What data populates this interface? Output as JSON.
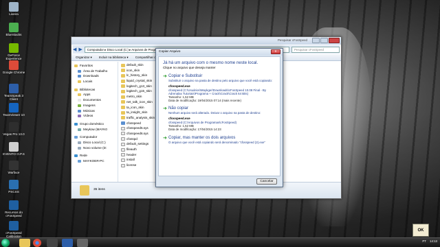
{
  "desktop": {
    "icons": [
      {
        "label": "Lixeira",
        "color": "#9fb4c8"
      },
      {
        "label": "BlueStacks",
        "color": "#4caf50"
      },
      {
        "label": "GeForce Experience",
        "color": "#76b900"
      },
      {
        "label": "Google Chrome",
        "color": "#dd4b39"
      },
      {
        "label": "TeamSpeak 3 Client",
        "color": "#2d5ea8"
      },
      {
        "label": "TeamViewer 10",
        "color": "#1565c0"
      },
      {
        "label": "Vegas Pro 13.0",
        "color": "#2e2e2e"
      },
      {
        "label": "EVENTO O.P.S",
        "color": "#cfcfcf"
      },
      {
        "label": "Warface",
        "color": "#333333"
      },
      {
        "label": "PSCSS",
        "color": "#2a6fb0"
      },
      {
        "label": "Recursos do cFosSpeed",
        "color": "#1f5fa0"
      },
      {
        "label": "cFosSpeed Calibration",
        "color": "#1f5fa0"
      }
    ]
  },
  "explorer": {
    "address_text": "Computador ▸ Disco Local (C:) ▸ Arquivos de Programas ▸ cFosSpeed ▸",
    "search_placeholder": "Pesquisar cFosSpeed",
    "title_right": "Pesquisar cFosSpeed",
    "toolbar": {
      "organize": "Organizar ▾",
      "include_library": "Incluir na biblioteca ▾",
      "share": "Compartilhar com ▾"
    },
    "nav": [
      {
        "label": "Favoritos",
        "head": true,
        "color": "#e8c65a"
      },
      {
        "label": "Área de Trabalho",
        "head": false,
        "color": "#5a8fd0"
      },
      {
        "label": "Downloads",
        "head": false,
        "color": "#5a8fd0"
      },
      {
        "label": "Locais",
        "head": false,
        "color": "#e8c65a"
      },
      {
        "label": "",
        "gap": true
      },
      {
        "label": "Bibliotecas",
        "head": true,
        "color": "#e8c65a"
      },
      {
        "label": "Apps",
        "head": false,
        "color": "#e8c65a"
      },
      {
        "label": "Documentos",
        "head": false,
        "color": "#e8e8e8"
      },
      {
        "label": "Imagens",
        "head": false,
        "color": "#7cb342"
      },
      {
        "label": "Músicas",
        "head": false,
        "color": "#5a8fd0"
      },
      {
        "label": "Vídeos",
        "head": false,
        "color": "#8e6fb8"
      },
      {
        "label": "",
        "gap": true
      },
      {
        "label": "Grupo doméstico",
        "head": true,
        "color": "#3a8fd0"
      },
      {
        "label": "Meykow (MAYK0",
        "head": false,
        "color": "#7aa"
      },
      {
        "label": "",
        "gap": true
      },
      {
        "label": "Computador",
        "head": true,
        "color": "#6aa0d8"
      },
      {
        "label": "Disco Local (C:)",
        "head": false,
        "color": "#9ab"
      },
      {
        "label": "Novo volume (D:",
        "head": false,
        "color": "#9ab"
      },
      {
        "label": "",
        "gap": true
      },
      {
        "label": "Rede",
        "head": true,
        "color": "#3a8fd0"
      },
      {
        "label": "MAYKOER-PC",
        "head": false,
        "color": "#6aa0d8"
      }
    ],
    "files": [
      {
        "label": "default_skin",
        "type": "folder"
      },
      {
        "label": "icon_skin",
        "type": "folder"
      },
      {
        "label": "lc_history_skin",
        "type": "folder"
      },
      {
        "label": "liquid_crystal_skin",
        "type": "folder"
      },
      {
        "label": "logitech_g13_skin",
        "type": "folder"
      },
      {
        "label": "logitech_g15_skin",
        "type": "folder"
      },
      {
        "label": "metro_skin",
        "type": "folder"
      },
      {
        "label": "net_talk_icon_skin",
        "type": "folder"
      },
      {
        "label": "ta_icon_skin",
        "type": "folder"
      },
      {
        "label": "ta_insight_skin",
        "type": "folder"
      },
      {
        "label": "traffic_analysis_skin",
        "type": "folder"
      },
      {
        "label": "cfosspeed",
        "type": "exe"
      },
      {
        "label": "cfosspeed5.sys",
        "type": "doc"
      },
      {
        "label": "cfosspeed6.sys",
        "type": "doc"
      },
      {
        "label": "cfosspd",
        "type": "doc"
      },
      {
        "label": "default_settings",
        "type": "doc"
      },
      {
        "label": "fileauth",
        "type": "doc"
      },
      {
        "label": "header",
        "type": "doc"
      },
      {
        "label": "install",
        "type": "doc"
      },
      {
        "label": "license",
        "type": "doc"
      }
    ],
    "status": "35 itens"
  },
  "dialog": {
    "title": "Copiar Arquivo",
    "close": "x",
    "heading": "Já há um arquivo com o mesmo nome neste local.",
    "subheading": "Clique no arquivo que deseja manter",
    "option_replace": {
      "title": "Copiar e Substituir",
      "desc": "Substituir o arquivo na pasta de destino pelo arquivo que você está copiando:",
      "file_name": "cfosspeed.exe",
      "path": "cfosspeed (C:\\Usuários\\Maykger\\Downloads\\cFosSpeed 10.08 Final - By Adrenalax Tutoriais\\Programa + Crack\\Crack\\Crack 64 Bits)",
      "size": "Tamanho: 1,52 MB",
      "date": "Data de modificação: 19/04/2015 07:14 (mais recente)"
    },
    "option_skip": {
      "title": "Não copiar",
      "desc": "Nenhum arquivo será alterado. Deixar o arquivo na pasta de destino:",
      "file_name": "cfosspeed.exe",
      "path": "cfosspeed (C:\\Arquivos de Programas\\cFosSpeed)",
      "size": "Tamanho: 1,52 MB",
      "date": "Data de modificação: 17/04/2015 14:23"
    },
    "option_keep_both": {
      "title": "Copiar, mas manter os dois arquivos",
      "desc": "O arquivo que você está copiando será denominado \"cfosspeed (2).exe\""
    },
    "cancel": "Cancelar"
  },
  "taskbar": {
    "language": "PT",
    "time": "14:13",
    "date": "19/04/2015"
  },
  "ok_badge": "OK"
}
